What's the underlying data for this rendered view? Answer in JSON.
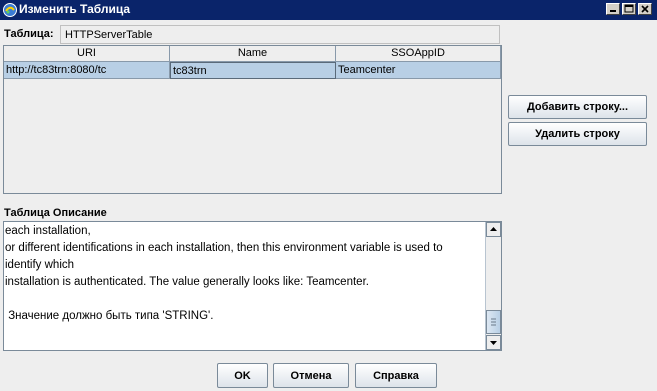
{
  "window": {
    "title": "Изменить Таблица",
    "icon": "app-icon",
    "controls": [
      "minimize-icon",
      "maximize-icon",
      "close-icon"
    ]
  },
  "table": {
    "label": "Таблица:",
    "name": "HTTPServerTable",
    "columns": [
      "URI",
      "Name",
      "SSOAppID"
    ],
    "rows": [
      [
        "http://tc83trn:8080/tc",
        "tc83trn",
        "Teamcenter"
      ]
    ]
  },
  "side_buttons": {
    "add_row": "Добавить строку...",
    "delete_row": "Удалить строку"
  },
  "description": {
    "label": "Таблица Описание",
    "lines": [
      "each installation,",
      "or different identifications in each installation, then this environment variable is used to",
      "identify which",
      "installation is authenticated. The value generally looks like: Teamcenter.",
      "",
      " Значение должно быть типа 'STRING'."
    ]
  },
  "footer": {
    "ok": "OK",
    "cancel": "Отмена",
    "help": "Справка"
  },
  "colors": {
    "titlebar": "#0a246a",
    "selected_row": "#b8cfe5",
    "background": "#eeeeee"
  }
}
